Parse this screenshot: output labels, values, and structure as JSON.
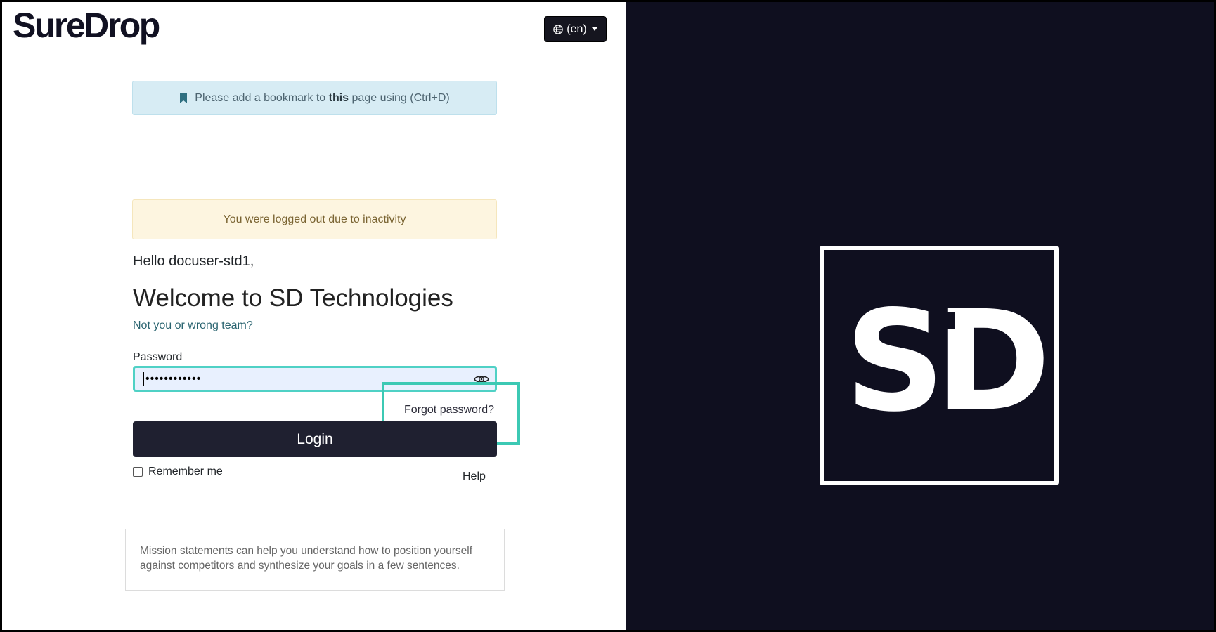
{
  "brand": {
    "logo_text": "SureDrop"
  },
  "language": {
    "label": "(en)"
  },
  "bookmark_alert": {
    "prefix": "Please add a bookmark to",
    "bold": "this",
    "suffix": "page using (Ctrl+D)"
  },
  "logout_alert": {
    "text": "You were logged out due to inactivity"
  },
  "greeting": "Hello docuser-std1,",
  "welcome_title": "Welcome to SD Technologies",
  "not_you_link": "Not you or wrong team?",
  "password": {
    "label": "Password",
    "masked_value": "••••••••••••"
  },
  "forgot_link": "Forgot password?",
  "login_button": "Login",
  "remember_label": "Remember me",
  "help_link": "Help",
  "mission_text": "Mission statements can help you understand how to position yourself against competitors and synthesize your goals in a few sentences.",
  "side_logo": {
    "text": "SD"
  },
  "colors": {
    "accent": "#3cc9b4",
    "dark_panel": "#0f0f1f",
    "button_dark": "#1f2030"
  },
  "icons": {
    "bookmark": "bookmark-icon",
    "globe": "globe-icon",
    "eye": "eye-icon"
  }
}
